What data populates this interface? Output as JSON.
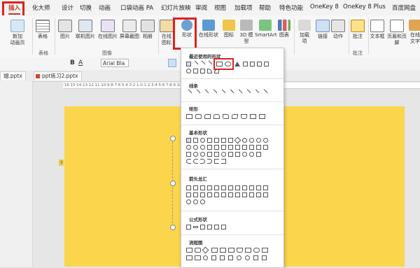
{
  "tabs": [
    "插入",
    "化大师",
    "设计",
    "切换",
    "动画",
    "口袋动画 PA",
    "幻灯片放映",
    "审阅",
    "视图",
    "加载项",
    "帮助",
    "特色功能",
    "OneKey 8",
    "OneKey 8 Plus",
    "百度网盘"
  ],
  "ribbon": {
    "buttons": [
      "新加\n动画页",
      "表格",
      "图片",
      "联机图片",
      "在线图片",
      "屏幕截图",
      "相册",
      "在线\n图标",
      "形状",
      "在线形状",
      "图标",
      "3D 模型",
      "SmartArt",
      "图表",
      "加载\n项",
      "链接",
      "动作",
      "批注",
      "文本框",
      "页眉和页脚",
      "在线\n文字"
    ],
    "groups": [
      "表格",
      "图像",
      "批注"
    ]
  },
  "formatbar": {
    "font": "Arial Bla",
    "bold": "B",
    "italic": "A"
  },
  "filetabs": [
    "烟.pptx",
    "ppt练习2.pptx"
  ],
  "ruler": "·16·15·14·13·12·11·10·9·8·7·6·5·4·3·2·1·0·1·2·3·4·5·6·7·8·9·10·11·12·13·14·15·16·",
  "dropdown": {
    "sections": [
      "最近使用的形状",
      "线条",
      "矩形",
      "基本形状",
      "箭头总汇",
      "公式形状",
      "流程图"
    ]
  },
  "slide_marker": "⇕",
  "colors": {
    "slide": "#fbd54b",
    "highlight": "#e02020",
    "accent": "#c43b1d"
  }
}
